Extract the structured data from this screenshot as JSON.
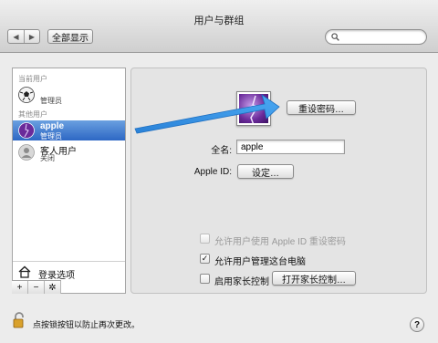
{
  "window": {
    "title": "用户与群组"
  },
  "toolbar": {
    "show_all": "全部显示",
    "search_placeholder": ""
  },
  "sidebar": {
    "current_header": "当前用户",
    "current_user": {
      "name": "",
      "role": "管理员"
    },
    "others_header": "其他用户",
    "users": [
      {
        "name": "apple",
        "role": "管理员"
      },
      {
        "name": "客人用户",
        "role": "关闭"
      }
    ],
    "login_options": "登录选项",
    "tools": [
      "+",
      "−",
      "✲"
    ]
  },
  "panel": {
    "reset_password": "重设密码…",
    "fullname_label": "全名:",
    "fullname_value": "apple",
    "appleid_label": "Apple ID:",
    "appleid_button": "设定…",
    "checks": [
      {
        "label": "允许用户使用 Apple ID 重设密码",
        "checked": false,
        "disabled": true
      },
      {
        "label": "允许用户管理这台电脑",
        "checked": true,
        "disabled": false
      },
      {
        "label": "启用家长控制",
        "checked": false,
        "disabled": false
      }
    ],
    "parental_button": "打开家长控制…"
  },
  "footer": {
    "lock_text": "点按锁按钮以防止再次更改。",
    "help": "?"
  },
  "colors": {
    "selection": "#2d67c4",
    "arrow": "#2f8fe3"
  }
}
